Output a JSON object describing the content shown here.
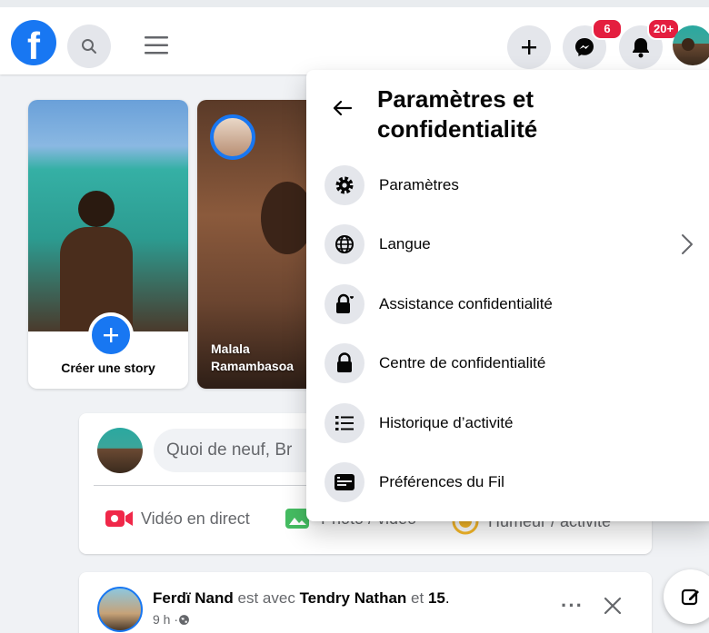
{
  "topbar": {
    "logo_letter": "f",
    "messenger_badge": "6",
    "notifications_badge": "20+"
  },
  "stories": {
    "create_label": "Créer une story",
    "friend_name_line1": "Malala",
    "friend_name_line2": "Ramambasoa"
  },
  "composer": {
    "placeholder": "Quoi de neuf, Br",
    "live_video": "Vidéo en direct",
    "photo_video": "Photo / vidéo",
    "feeling": "Humeur / activité"
  },
  "post": {
    "author": "Ferdï Nand",
    "with_text": " est avec ",
    "tagged": "Tendry Nathan",
    "and_text": " et ",
    "others": "15",
    "period": ".",
    "time": "9 h · "
  },
  "menu": {
    "title": "Paramètres et confidentialité",
    "items": [
      {
        "label": "Paramètres",
        "icon": "gear-icon"
      },
      {
        "label": "Langue",
        "icon": "globe-icon"
      },
      {
        "label": "Assistance confidentialité",
        "icon": "lock-heart-icon"
      },
      {
        "label": "Centre de confidentialité",
        "icon": "lock-icon"
      },
      {
        "label": "Historique d’activité",
        "icon": "list-icon"
      },
      {
        "label": "Préférences du Fil",
        "icon": "feed-icon"
      }
    ]
  },
  "colors": {
    "brand": "#1877f2",
    "badge": "#e41e3f",
    "live": "#f02849",
    "photo": "#45bd62",
    "feeling": "#f7b928"
  }
}
